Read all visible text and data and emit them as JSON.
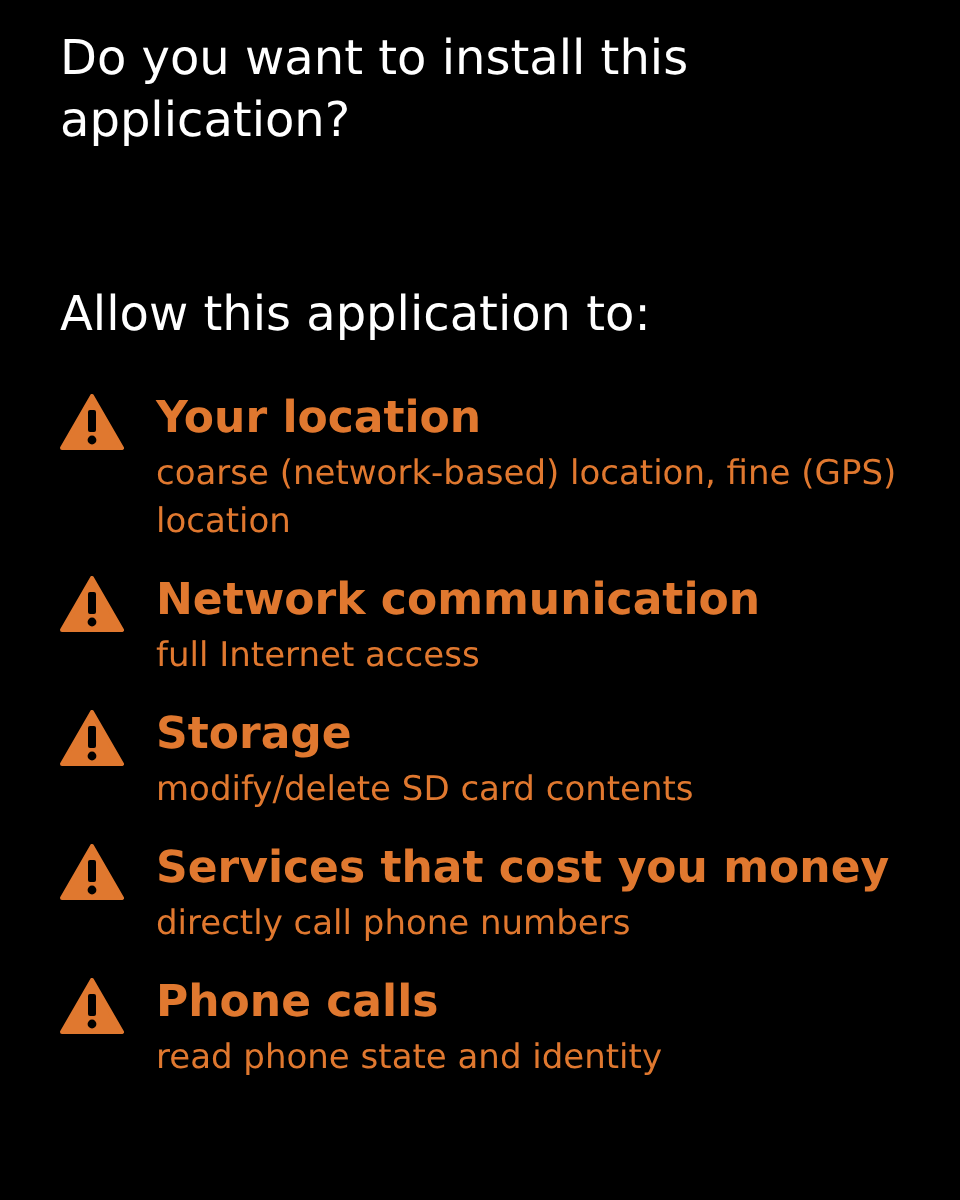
{
  "title": "Do you want to install this application?",
  "subtitle": "Allow this application to:",
  "permissions": [
    {
      "group": "Your location",
      "detail": "coarse (network-based) location, fine (GPS) location"
    },
    {
      "group": "Network communication",
      "detail": "full Internet access"
    },
    {
      "group": "Storage",
      "detail": "modify/delete SD card contents"
    },
    {
      "group": "Services that cost you money",
      "detail": "directly call phone numbers"
    },
    {
      "group": "Phone calls",
      "detail": "read phone state and identity"
    }
  ]
}
